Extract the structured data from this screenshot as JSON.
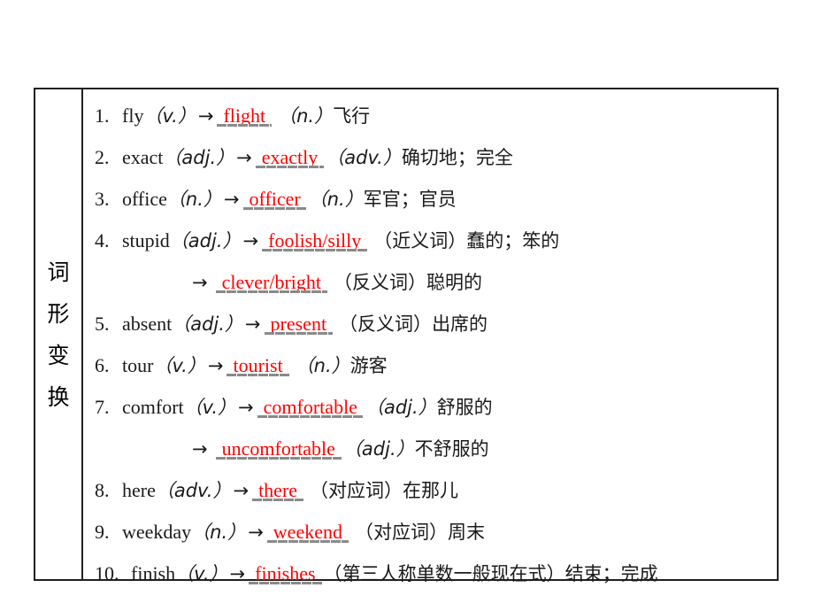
{
  "table": {
    "side_label_text": "词形变换",
    "side_label_chars": [
      "词",
      "形",
      "变",
      "换"
    ],
    "answer_color": "#ff0000",
    "text_color": "#1a1a1a",
    "underline_color": "#8a8a8a",
    "border_color": "#231f20"
  },
  "rows": [
    {
      "num": "1.",
      "word": "fly",
      "pos1": "（v.）",
      "arrow": "→",
      "answer": "flight",
      "pos2": "（n.）",
      "meaning": "飞行",
      "continuation": false
    },
    {
      "num": "2.",
      "word": "exact",
      "pos1": "（adj.）",
      "arrow": "→",
      "answer": "exactly",
      "pos2": "（adv.）",
      "meaning": "确切地；完全",
      "continuation": false
    },
    {
      "num": "3.",
      "word": "office",
      "pos1": "（n.）",
      "arrow": "→",
      "answer": "officer",
      "pos2": "（n.）",
      "meaning": "军官；官员",
      "continuation": false
    },
    {
      "num": "4.",
      "word": "stupid",
      "pos1": "（adj.）",
      "arrow": "→",
      "answer": "foolish/silly",
      "pos2": "（近义词）",
      "meaning": "蠢的；笨的",
      "continuation": false
    },
    {
      "num": "",
      "word": "",
      "pos1": "",
      "arrow": "→",
      "answer": "clever/bright",
      "pos2": "（反义词）",
      "meaning": "聪明的",
      "continuation": true
    },
    {
      "num": "5.",
      "word": "absent",
      "pos1": "（adj.）",
      "arrow": "→",
      "answer": "present",
      "pos2": "（反义词）",
      "meaning": "出席的",
      "continuation": false
    },
    {
      "num": "6.",
      "word": "tour",
      "pos1": "（v.）",
      "arrow": "→",
      "answer": "tourist",
      "pos2": "（n.）",
      "meaning": "游客",
      "continuation": false
    },
    {
      "num": "7.",
      "word": "comfort",
      "pos1": "（v.）",
      "arrow": "→",
      "answer": "comfortable",
      "pos2": "（adj.）",
      "meaning": "舒服的",
      "continuation": false
    },
    {
      "num": "",
      "word": "",
      "pos1": "",
      "arrow": "→",
      "answer": "uncomfortable",
      "pos2": "（adj.）",
      "meaning": "不舒服的",
      "continuation": true
    },
    {
      "num": "8.",
      "word": "here",
      "pos1": "（adv.）",
      "arrow": "→",
      "answer": "there",
      "pos2": "（对应词）",
      "meaning": "在那儿",
      "continuation": false
    },
    {
      "num": "9.",
      "word": "weekday",
      "pos1": "（n.）",
      "arrow": "→",
      "answer": "weekend",
      "pos2": "（对应词）",
      "meaning": "周末",
      "continuation": false
    },
    {
      "num": "10.",
      "word": "finish",
      "pos1": "（v.）",
      "arrow": "→",
      "answer": "finishes",
      "pos2": "（第三人称单数一般现在式）",
      "meaning": "结束；完成",
      "continuation": false
    }
  ]
}
